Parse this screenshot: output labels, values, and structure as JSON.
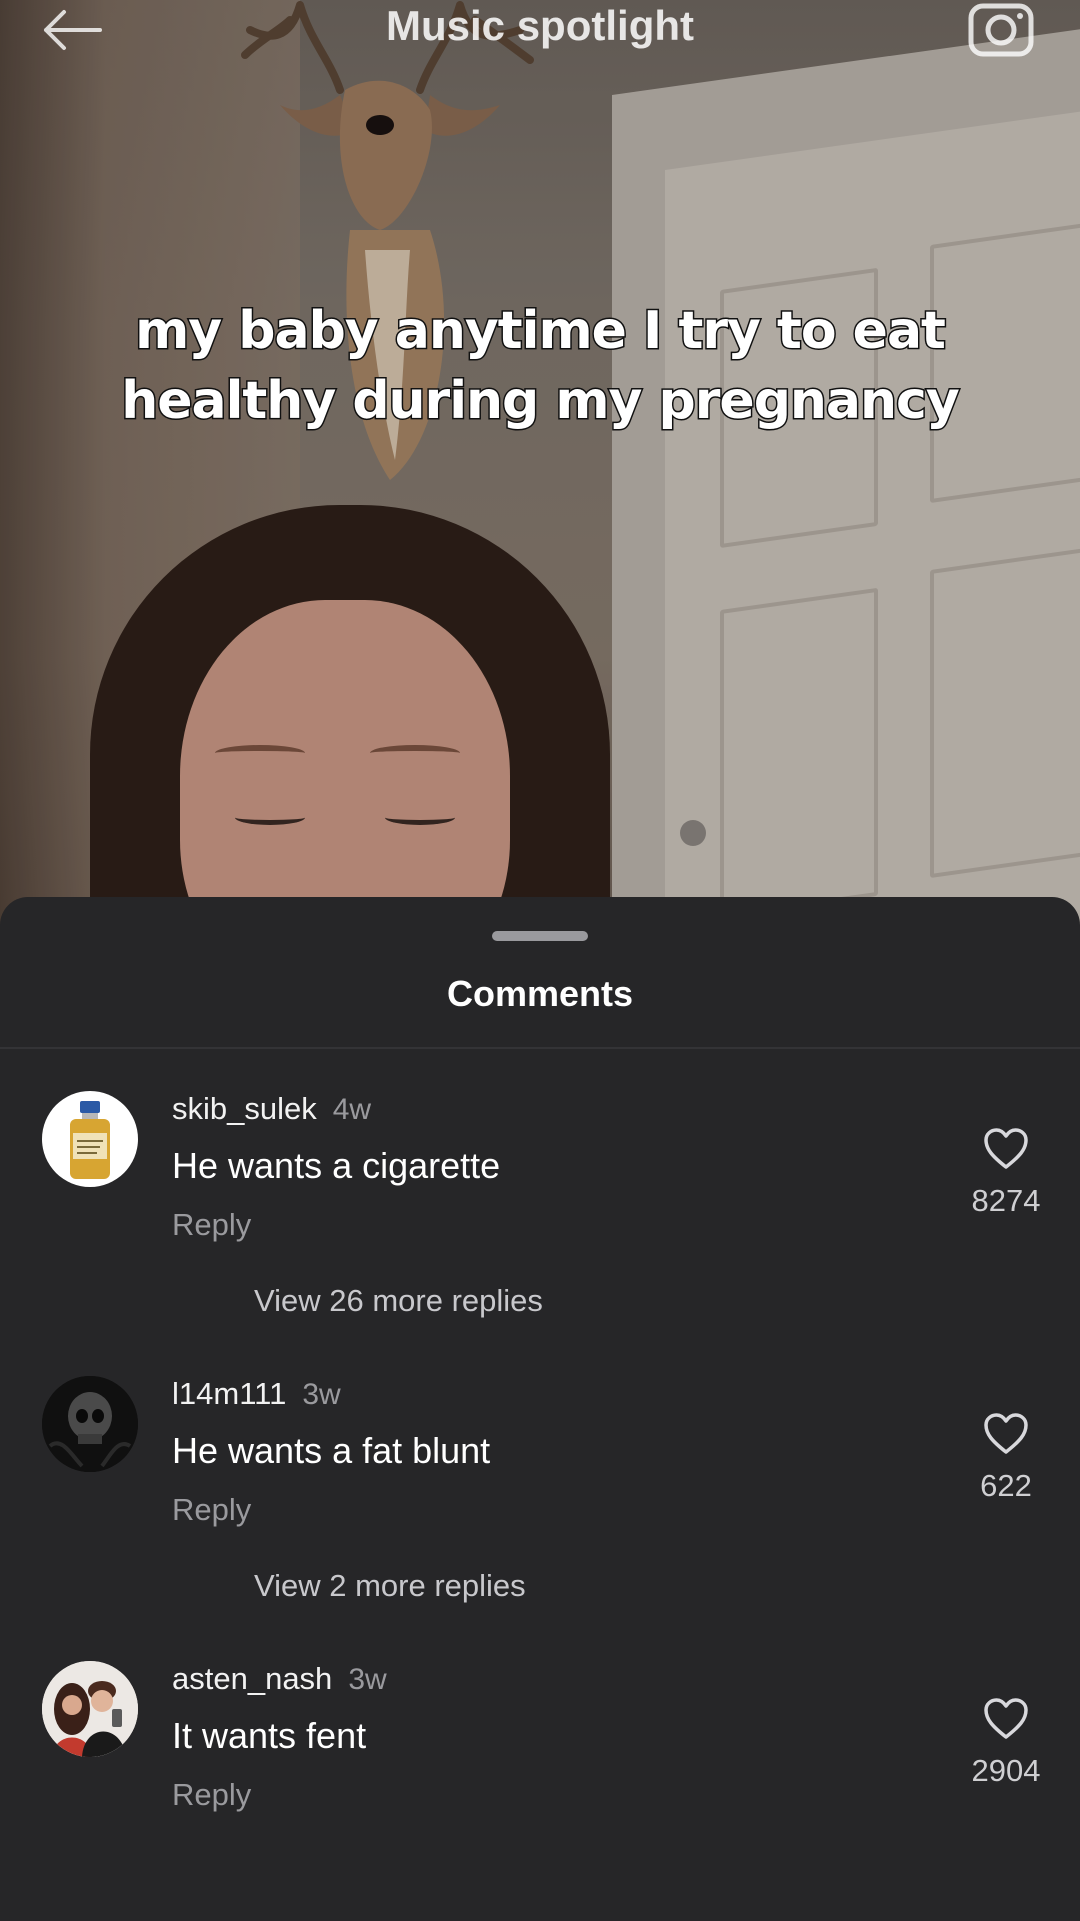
{
  "header": {
    "title": "Music spotlight",
    "back_icon": "arrow-left-icon",
    "camera_icon": "camera-icon"
  },
  "video": {
    "caption_line1": "my baby anytime I try to eat",
    "caption_line2": "healthy during my pregnancy"
  },
  "comments_sheet": {
    "title": "Comments",
    "items": [
      {
        "username": "skib_sulek",
        "time": "4w",
        "text": "He wants a cigarette",
        "reply_label": "Reply",
        "likes": "8274",
        "view_more": "View 26 more replies"
      },
      {
        "username": "l14m111",
        "time": "3w",
        "text": "He wants a fat blunt",
        "reply_label": "Reply",
        "likes": "622",
        "view_more": "View 2 more replies"
      },
      {
        "username": "asten_nash",
        "time": "3w",
        "text": "It wants fent",
        "reply_label": "Reply",
        "likes": "2904"
      }
    ]
  },
  "colors": {
    "sheet_background": "#262628",
    "primary_text": "#ffffff",
    "secondary_text": "#9a9a9e"
  }
}
